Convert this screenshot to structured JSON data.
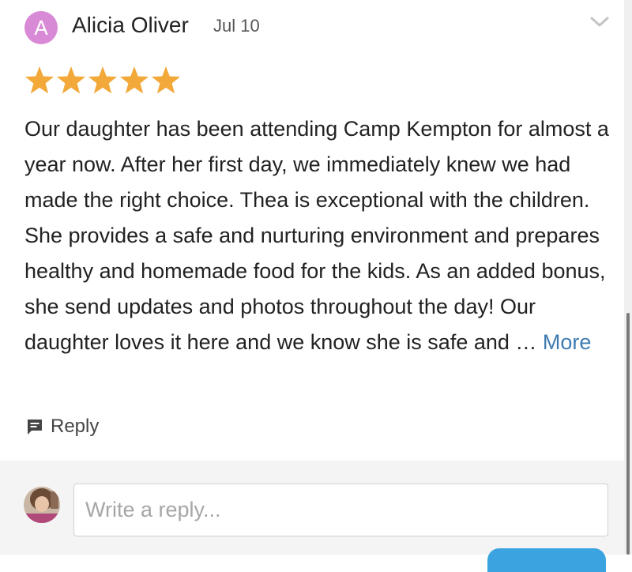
{
  "review": {
    "author_initial": "A",
    "author_name": "Alicia Oliver",
    "date": "Jul 10",
    "rating": 5,
    "rating_max": 5,
    "body": "Our daughter has been attending Camp Kempton for almost a year now. After her first day, we immediately knew we had made the right choice. Thea is exceptional with the children. She provides a safe and nurturing environment and prepares healthy and homemade food for the kids. As an added bonus, she send updates and photos throughout the day! Our daughter loves it here and we know she is safe and … ",
    "more_label": "More",
    "reply_label": "Reply"
  },
  "composer": {
    "placeholder": "Write a reply..."
  },
  "icons": {
    "menu": "chevron-down-icon",
    "reply": "comment-icon",
    "rating": "star-icon"
  },
  "colors": {
    "avatar_bg": "#d98ad6",
    "star": "#f2a93a",
    "link": "#3e7bb0",
    "submit_button": "#3aa3e0"
  }
}
